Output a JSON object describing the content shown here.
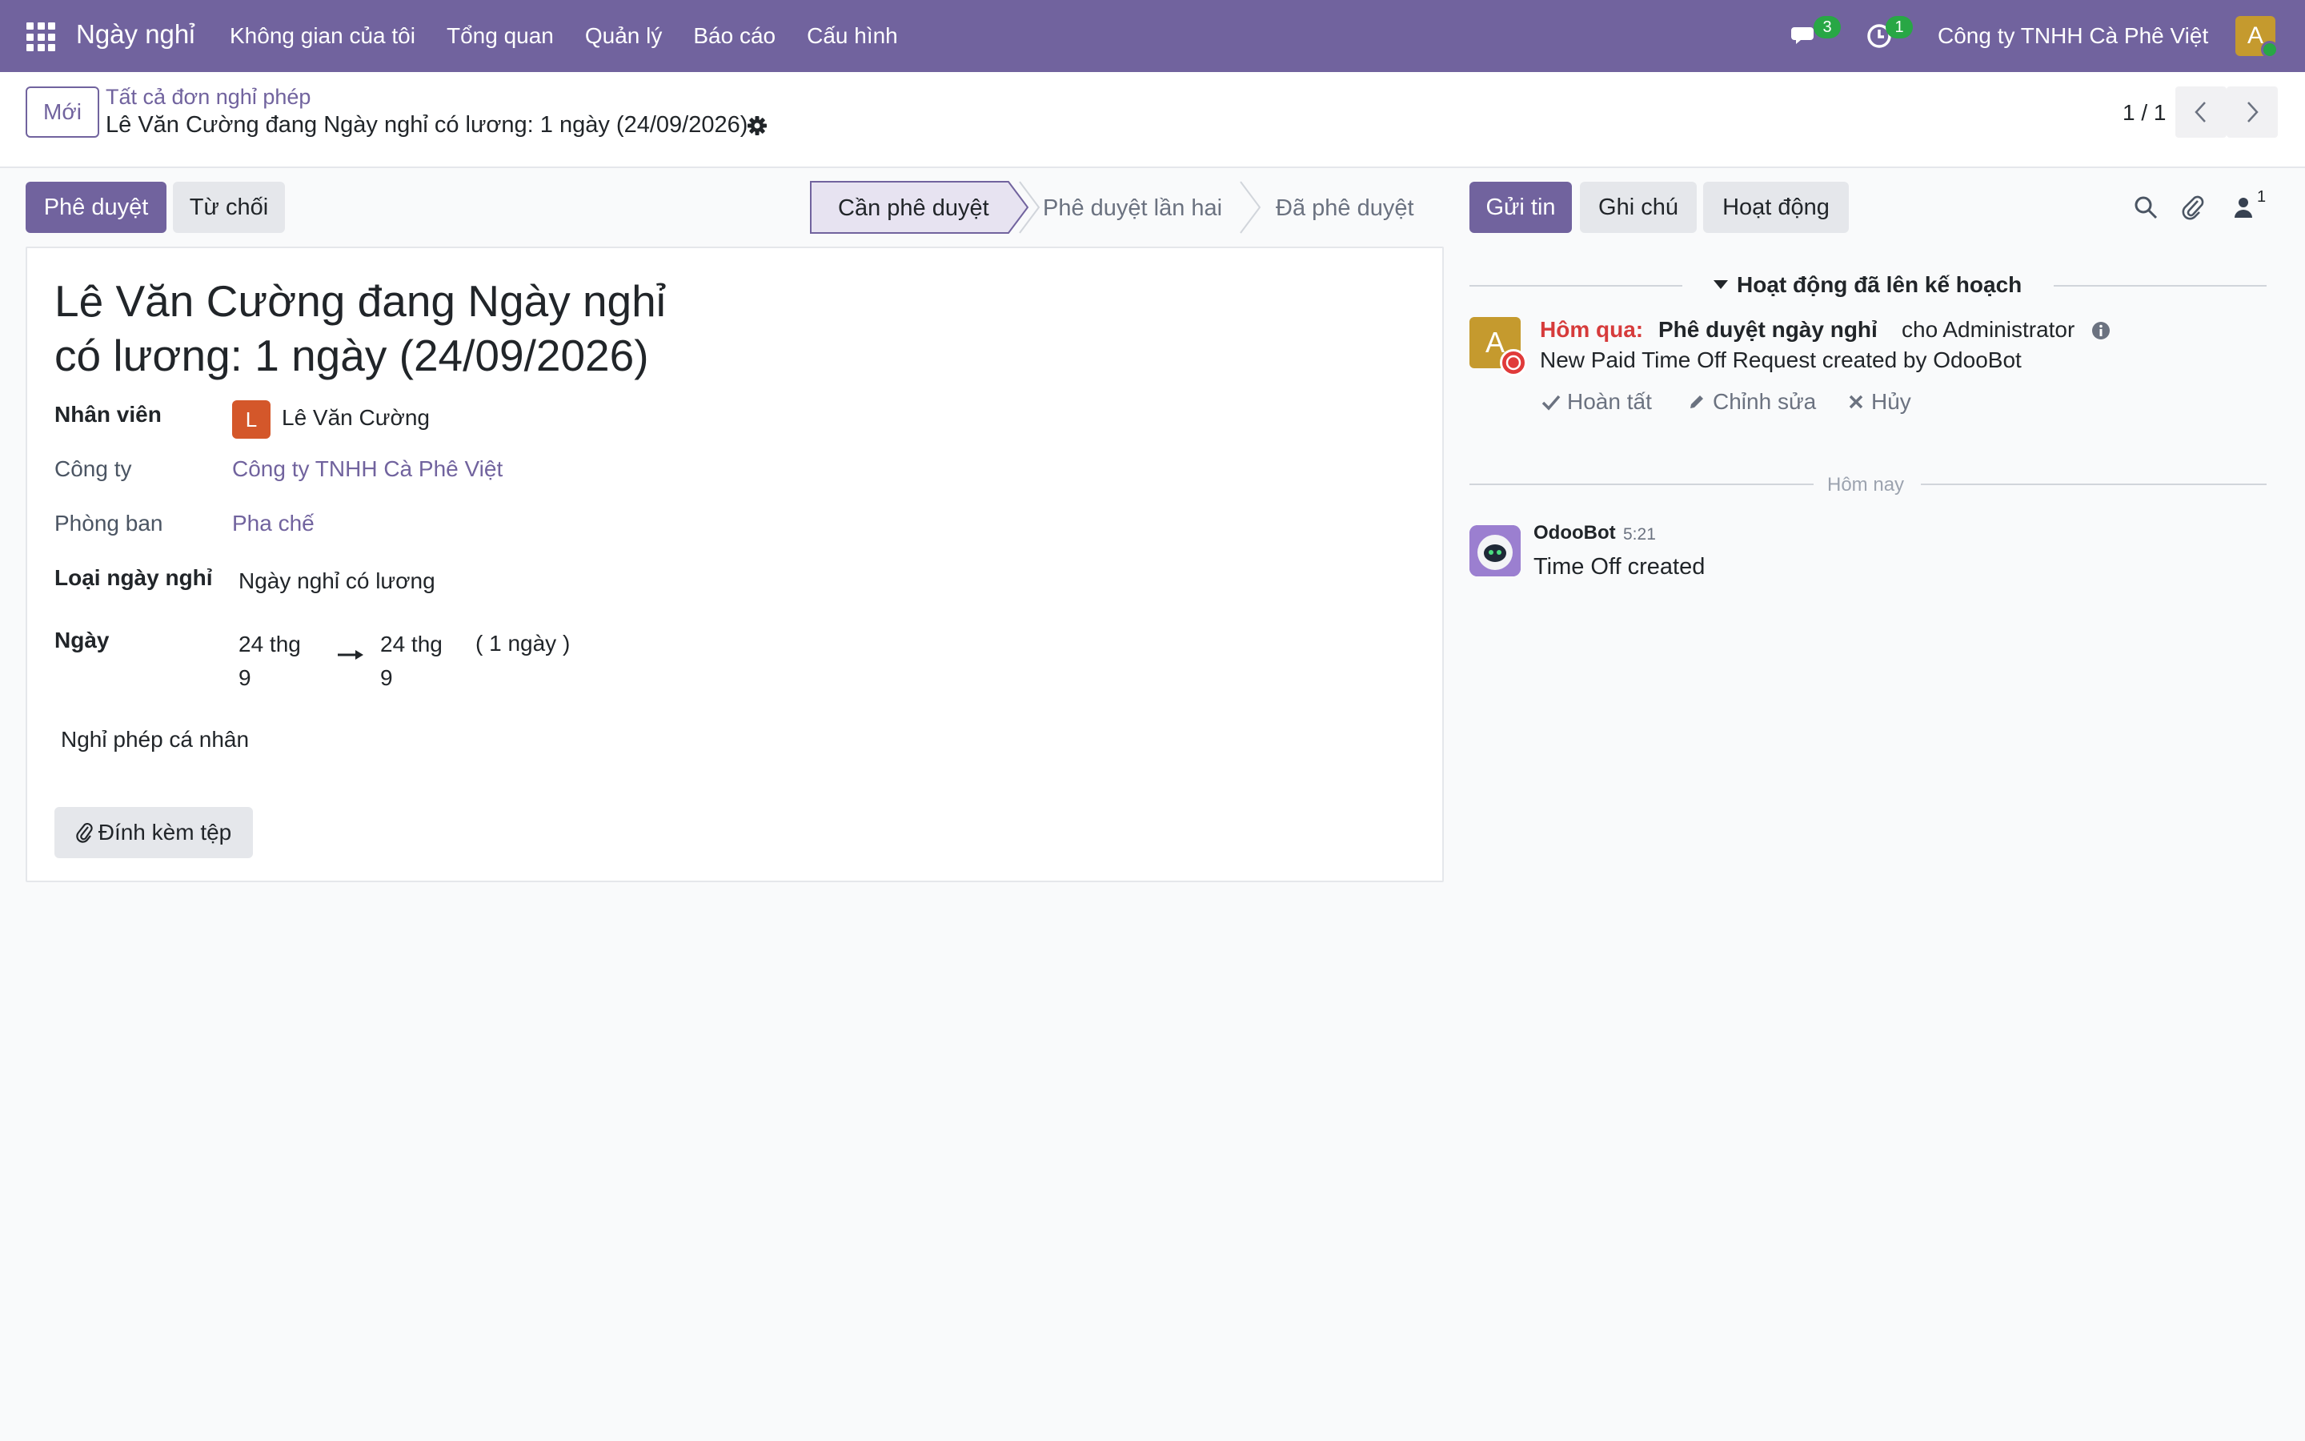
{
  "navbar": {
    "app_name": "Ngày nghỉ",
    "menu": [
      "Không gian của tôi",
      "Tổng quan",
      "Quản lý",
      "Báo cáo",
      "Cấu hình"
    ],
    "messages_count": "3",
    "activities_count": "1",
    "company": "Công ty TNHH Cà Phê Việt",
    "user_initial": "A"
  },
  "control_panel": {
    "new_label": "Mới",
    "breadcrumb_parent": "Tất cả đơn nghỉ phép",
    "breadcrumb_current": "Lê Văn Cường đang Ngày nghỉ có lương: 1 ngày (24/09/2026)",
    "pager": "1 / 1"
  },
  "actions": {
    "approve": "Phê duyệt",
    "refuse": "Từ chối"
  },
  "status": {
    "stages": [
      "Cần phê duyệt",
      "Phê duyệt lần hai",
      "Đã phê duyệt"
    ],
    "active_index": 0
  },
  "form": {
    "title_line1": "Lê Văn Cường đang Ngày nghỉ",
    "title_line2": "có lương: 1 ngày (24/09/2026)",
    "employee_label": "Nhân viên",
    "employee_initial": "L",
    "employee_name": "Lê Văn Cường",
    "company_label": "Công ty",
    "company_value": "Công ty TNHH Cà Phê Việt",
    "department_label": "Phòng ban",
    "department_value": "Pha chế",
    "leave_type_label": "Loại ngày nghỉ",
    "leave_type_value": "Ngày nghỉ có lương",
    "dates_label": "Ngày",
    "date_from_line1": "24 thg",
    "date_from_line2": "9",
    "date_to_line1": "24 thg",
    "date_to_line2": "9",
    "duration": "( 1 ngày )",
    "description": "Nghỉ phép cá nhân",
    "attach_label": "Đính kèm tệp"
  },
  "chatter": {
    "send_message": "Gửi tin",
    "log_note": "Ghi chú",
    "activities": "Hoạt động",
    "followers_count": "1",
    "planned_title": "Hoạt động đã lên kế hoạch",
    "activity": {
      "avatar_initial": "A",
      "when": "Hôm qua:",
      "summary": "Phê duyệt ngày nghỉ",
      "assigned": "cho Administrator",
      "note": "New Paid Time Off Request created by OdooBot",
      "done": "Hoàn tất",
      "edit": "Chỉnh sửa",
      "cancel": "Hủy"
    },
    "today_label": "Hôm nay",
    "message": {
      "author": "OdooBot",
      "time": "5:21",
      "body": "Time Off created"
    }
  },
  "colors": {
    "brand": "#71639e",
    "badge": "#28a745",
    "overdue": "#d63b3b",
    "employee_avatar": "#d4572a",
    "user_avatar": "#c59a2e"
  }
}
